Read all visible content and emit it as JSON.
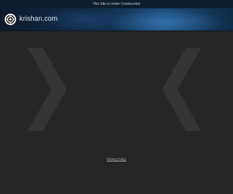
{
  "notice": {
    "text": "This Site is Under Construction"
  },
  "header": {
    "logo_icon": "gear-icon",
    "site_name": "krishan.com"
  },
  "main": {
    "left_arrow_icon": "chevron-right-icon",
    "right_arrow_icon": "chevron-left-icon"
  },
  "footer": {
    "privacy_link": "Privacy Policy"
  },
  "colors": {
    "notice_bg": "#0f1c2b",
    "header_accent": "#1b4e7f",
    "page_bg": "#262626",
    "chevron": "#353535"
  }
}
